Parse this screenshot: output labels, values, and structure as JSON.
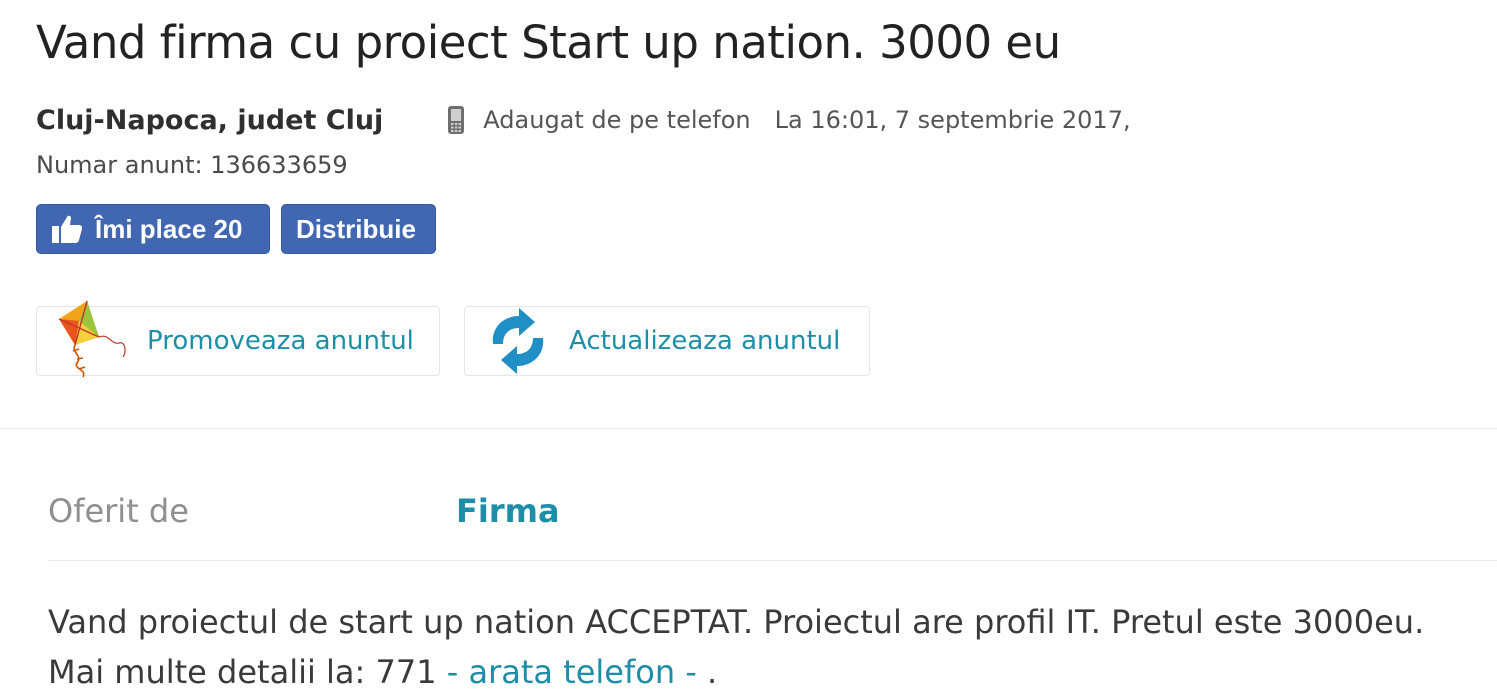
{
  "listing": {
    "title": "Vand firma cu proiect Start up nation. 3000 eu",
    "location": "Cluj-Napoca, judet Cluj",
    "added_via": "Adaugat de pe telefon",
    "date": "La 16:01, 7 septembrie 2017,",
    "ad_number": "Numar anunt: 136633659"
  },
  "social": {
    "like_label": "Îmi place 20",
    "share_label": "Distribuie",
    "brand_color": "#4267b2"
  },
  "actions": {
    "promote_label": "Promoveaza anuntul",
    "refresh_label": "Actualizeaza anuntul",
    "link_color": "#1e8ea8"
  },
  "details": {
    "offered_by_label": "Oferit de",
    "offered_by_value": "Firma"
  },
  "description": {
    "text_before": "Vand proiectul de start up nation ACCEPTAT. Proiectul are profil IT. Pretul este 3000eu. Mai multe detalii la: 771 ",
    "show_phone_label": "- arata telefon -",
    "text_after": " ."
  },
  "icons": {
    "phone": "mobile-phone-icon",
    "thumbs_up": "thumbs-up-icon",
    "kite": "kite-icon",
    "refresh": "refresh-icon"
  }
}
